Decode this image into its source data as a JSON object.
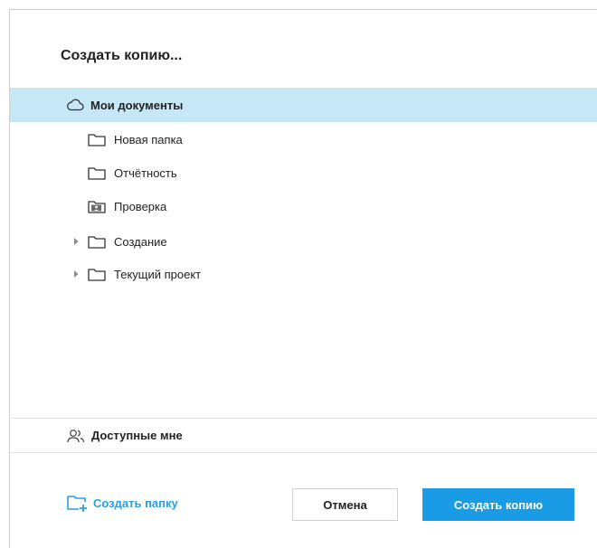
{
  "dialog": {
    "title": "Создать копию..."
  },
  "tree": {
    "root": {
      "label": "Мои документы",
      "icon": "cloud-icon",
      "selected": true
    },
    "children": [
      {
        "label": "Новая папка",
        "icon": "folder-icon",
        "expandable": false
      },
      {
        "label": "Отчётность",
        "icon": "folder-icon",
        "expandable": false
      },
      {
        "label": "Проверка",
        "icon": "shared-folder-icon",
        "expandable": false
      },
      {
        "label": "Создание",
        "icon": "folder-icon",
        "expandable": true
      },
      {
        "label": "Текущий проект",
        "icon": "folder-icon",
        "expandable": true
      }
    ]
  },
  "shared": {
    "label": "Доступные мне",
    "icon": "people-icon"
  },
  "footer": {
    "create_folder_label": "Создать папку",
    "cancel_label": "Отмена",
    "confirm_label": "Создать копию"
  },
  "colors": {
    "accent": "#1a9be6",
    "selected_row": "#c6e7f5",
    "link": "#2a9de3"
  }
}
